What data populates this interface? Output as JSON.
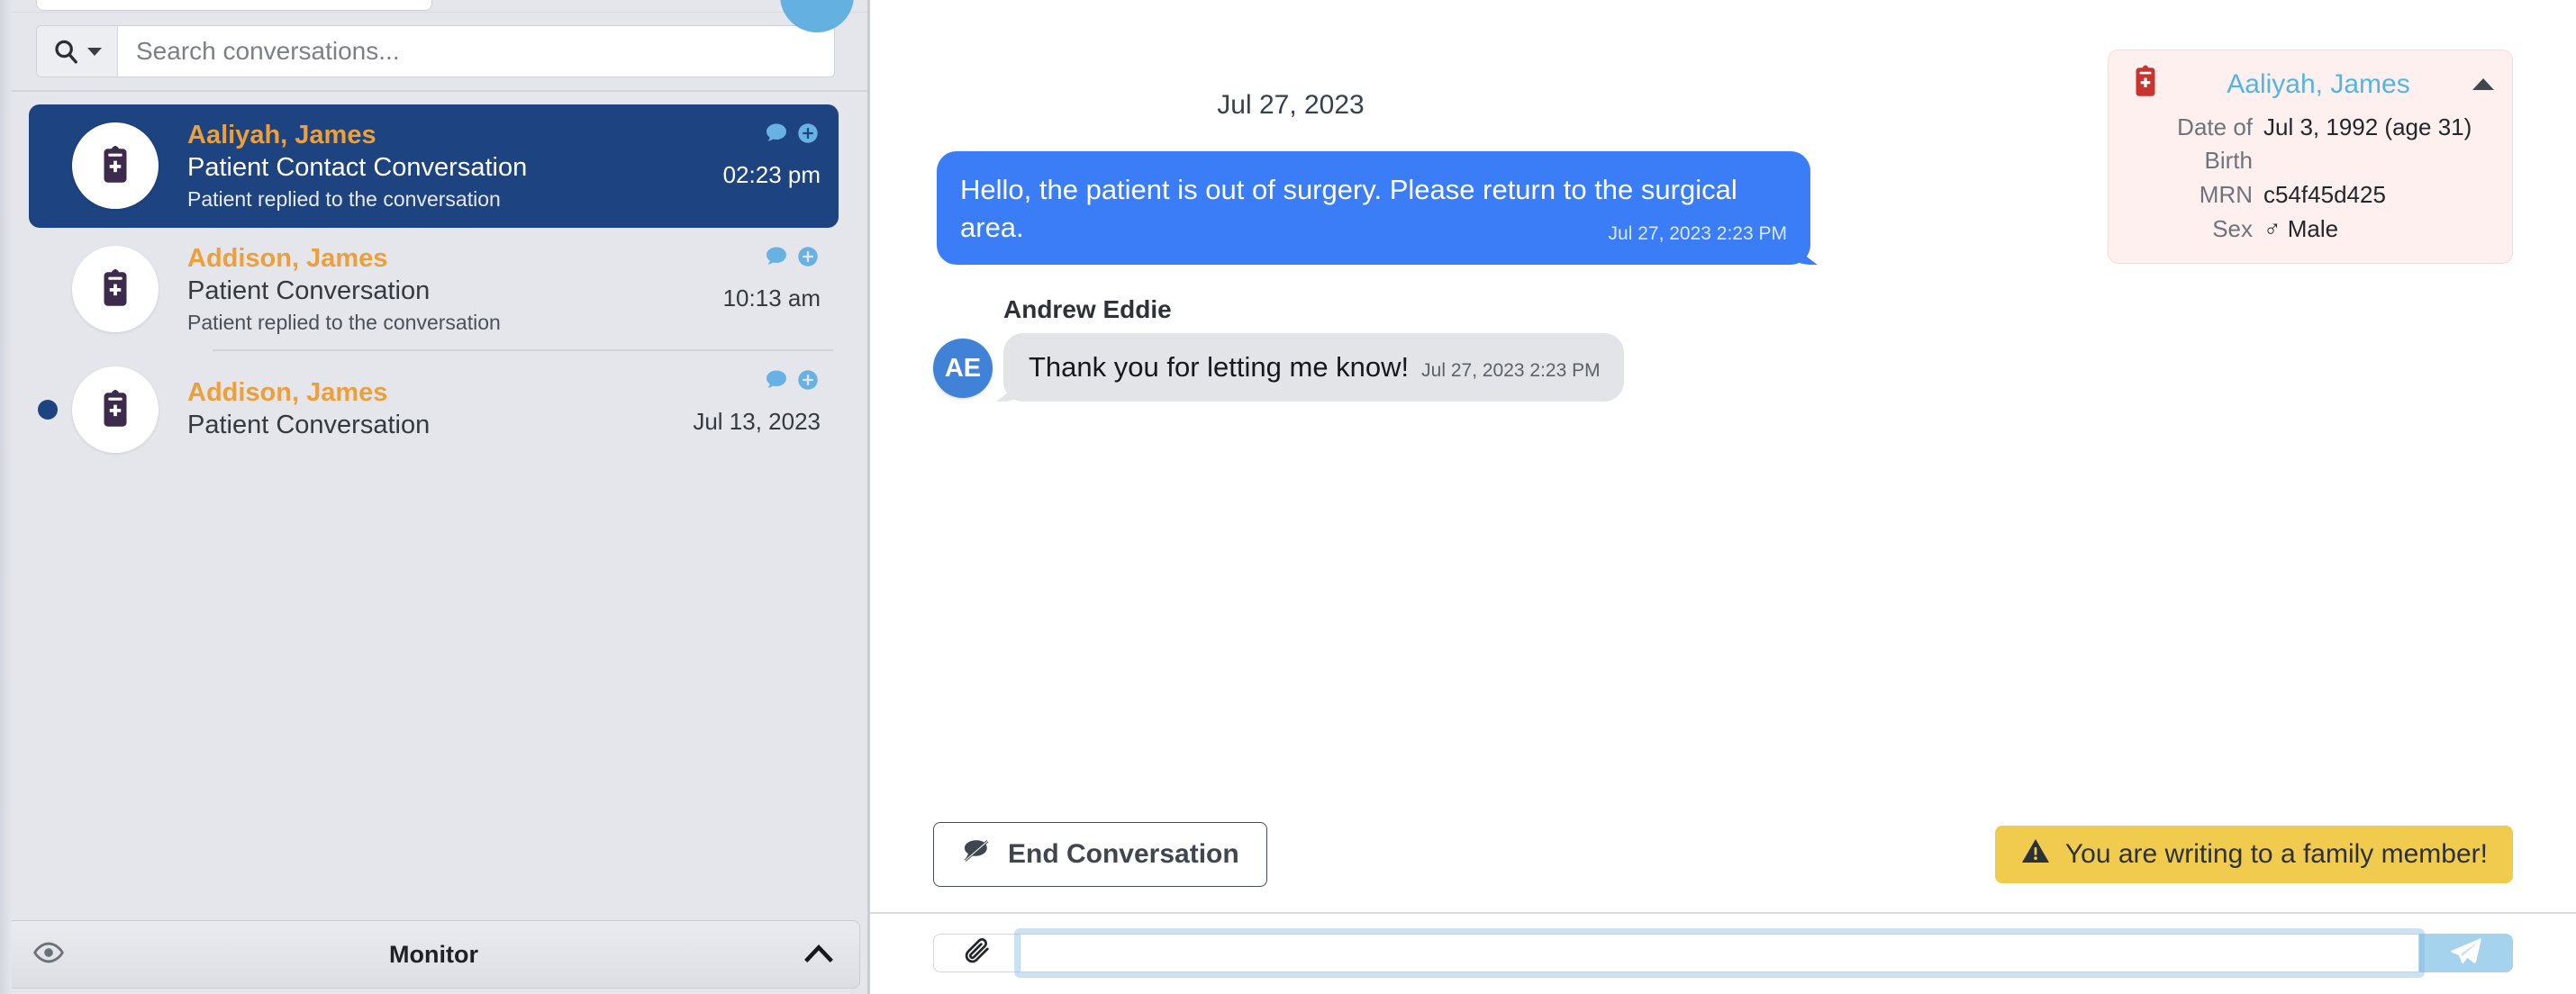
{
  "left_panel": {
    "search": {
      "placeholder": "Search conversations...",
      "value": "",
      "dropdown_icon": "search-icon"
    },
    "conversations": [
      {
        "name": "Aaliyah, James",
        "title": "Patient Contact Conversation",
        "subtitle": "Patient replied to the conversation",
        "time": "02:23 pm",
        "selected": true,
        "unread": false,
        "icons": [
          "comment-icon",
          "plus-circle-icon"
        ],
        "avatar_icon": "clipboard-medical-icon"
      },
      {
        "name": "Addison, James",
        "title": "Patient Conversation",
        "subtitle": "Patient replied to the conversation",
        "time": "10:13 am",
        "selected": false,
        "unread": false,
        "icons": [
          "comment-icon",
          "plus-circle-icon"
        ],
        "avatar_icon": "clipboard-medical-icon"
      },
      {
        "name": "Addison, James",
        "title": "Patient Conversation",
        "subtitle": "",
        "time": "Jul 13, 2023",
        "selected": false,
        "unread": true,
        "icons": [
          "comment-icon",
          "plus-circle-icon"
        ],
        "avatar_icon": "clipboard-medical-icon"
      }
    ],
    "monitor_bar": {
      "label": "Monitor",
      "left_icon": "eye-icon",
      "right_icon": "chevron-up-icon"
    }
  },
  "patient_card": {
    "icon": "clipboard-medical-red-icon",
    "name": "Aaliyah, James",
    "collapse_icon": "caret-up-icon",
    "fields": [
      {
        "label": "Date of Birth",
        "value": "Jul 3, 1992 (age 31)"
      },
      {
        "label": "MRN",
        "value": "c54f45d425"
      },
      {
        "label": "Sex",
        "value": "♂ Male"
      }
    ]
  },
  "conversation": {
    "date_separator": "Jul 27, 2023",
    "outgoing": {
      "text": "Hello, the patient is out of surgery. Please return to the surgical area.",
      "timestamp": "Jul 27, 2023 2:23 PM"
    },
    "incoming": {
      "sender": "Andrew Eddie",
      "avatar_initials": "AE",
      "text": "Thank you for letting me know!",
      "timestamp": "Jul 27, 2023 2:23 PM"
    }
  },
  "actions": {
    "end_conversation_label": "End Conversation",
    "end_conversation_icon": "comment-slash-icon",
    "warning_label": "You are writing to a family member!",
    "warning_icon": "warning-triangle-icon"
  },
  "composer": {
    "attach_icon": "paperclip-icon",
    "send_icon": "paper-plane-icon",
    "input_value": "",
    "input_placeholder": ""
  },
  "colors": {
    "selected_row": "#1d4380",
    "name_accent": "#eda03a",
    "outgoing_bubble": "#3b7df6",
    "incoming_bubble": "#e2e4e7",
    "warning_bg": "#f1cb4d",
    "patient_card_bg": "#fdf0ef",
    "send_button": "#a5d2ec",
    "patient_name": "#56b4e2"
  }
}
